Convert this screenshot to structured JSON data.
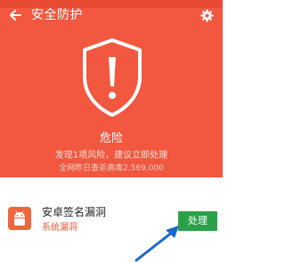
{
  "header": {
    "title": "安全防护",
    "back_icon": "back-arrow-icon",
    "settings_icon": "gear-icon"
  },
  "scan": {
    "status": "危险",
    "summary": "发现1项风险，建议立即处理",
    "stats": "全网昨日查杀病毒2,569,000"
  },
  "risk_item": {
    "name": "安卓签名漏洞",
    "category": "系统漏洞",
    "action_label": "处理",
    "icon": "android-icon"
  },
  "colors": {
    "danger": "#f2573f",
    "action": "#2aa149",
    "annotation": "#1a67c9"
  }
}
